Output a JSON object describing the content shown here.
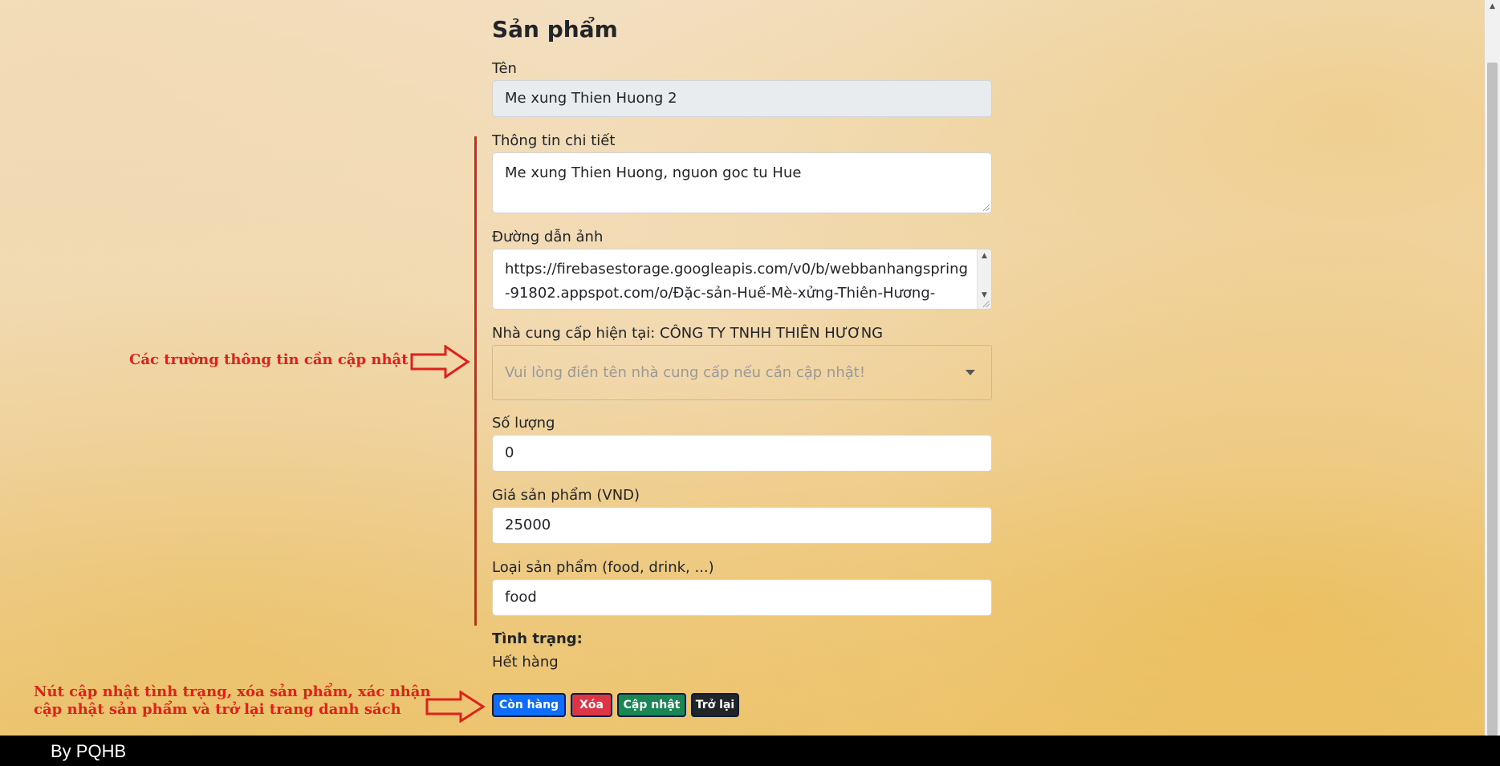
{
  "form": {
    "title": "Sản phẩm",
    "name_label": "Tên",
    "name_value": "Me xung Thien Huong 2",
    "detail_label": "Thông tin chi tiết",
    "detail_value": "Me xung Thien Huong, nguon goc tu Hue",
    "image_label": "Đường dẫn ảnh",
    "image_value_line1": "https://firebasestorage.googleapis.com/v0/b/webbanhangspring",
    "image_value_line2": "-91802.appspot.com/o/Đặc-sản-Huế-Mè-xửng-Thiên-Hương-",
    "supplier_label": "Nhà cung cấp hiện tại: CÔNG TY TNHH THIÊN HƯƠNG",
    "supplier_placeholder": "Vui lòng điền tên nhà cung cấp nếu cần cập nhật!",
    "quantity_label": "Số lượng",
    "quantity_value": "0",
    "price_label": "Giá sản phẩm (VND)",
    "price_value": "25000",
    "type_label": "Loại sản phẩm (food, drink, ...)",
    "type_value": "food",
    "status_label": "Tình trạng:",
    "status_value": "Hết hàng"
  },
  "buttons": {
    "instock": "Còn hàng",
    "delete": "Xóa",
    "update": "Cập nhật",
    "back": "Trở lại"
  },
  "annotations": {
    "fields_note": "Các trường thông tin cần cập nhật",
    "buttons_note_line1": "Nút cập nhật tình trạng, xóa sản phẩm, xác nhận",
    "buttons_note_line2": "cập nhật sản phẩm và trở lại trang danh sách"
  },
  "footer": {
    "text": "By PQHB"
  },
  "colors": {
    "primary": "#0d6efd",
    "danger": "#dc3545",
    "success": "#198754",
    "dark": "#212529",
    "annotation": "#e0201a"
  }
}
